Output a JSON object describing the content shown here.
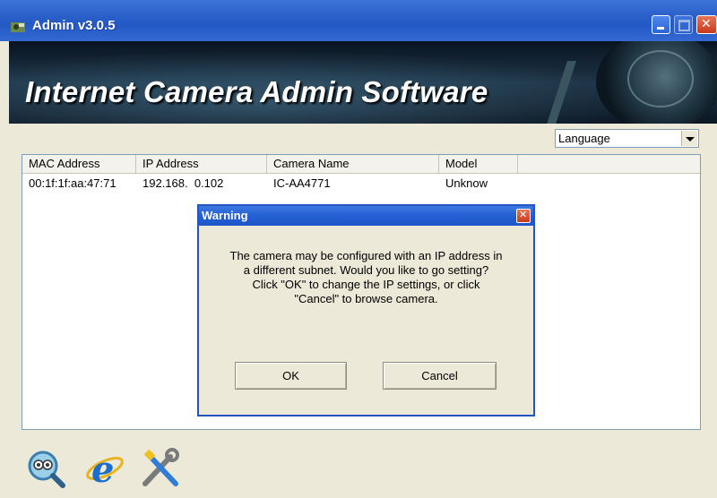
{
  "window": {
    "title": "Admin v3.0.5"
  },
  "banner": {
    "headline": "Internet Camera Admin Software"
  },
  "language": {
    "value": "Language"
  },
  "table": {
    "columns": [
      "MAC Address",
      "IP Address",
      "Camera Name",
      "Model"
    ],
    "rows": [
      {
        "mac": "00:1f:1f:aa:47:71",
        "ip": "192.168.  0.102",
        "name": "IC-AA4771",
        "model": "Unknow"
      }
    ]
  },
  "dialog": {
    "title": "Warning",
    "lines": [
      "The camera may be configured with an IP address in",
      "a different subnet. Would you like to go setting?",
      "Click \"OK\" to change the IP settings, or click",
      "\"Cancel\" to browse camera."
    ],
    "ok_label": "OK",
    "cancel_label": "Cancel"
  },
  "toolbar": {
    "icons": [
      "search-camera-icon",
      "internet-explorer-icon",
      "tools-icon"
    ]
  },
  "colors": {
    "titlebar": "#2a5fc9",
    "window_bg": "#ece9d8",
    "close_red": "#c9391b"
  }
}
